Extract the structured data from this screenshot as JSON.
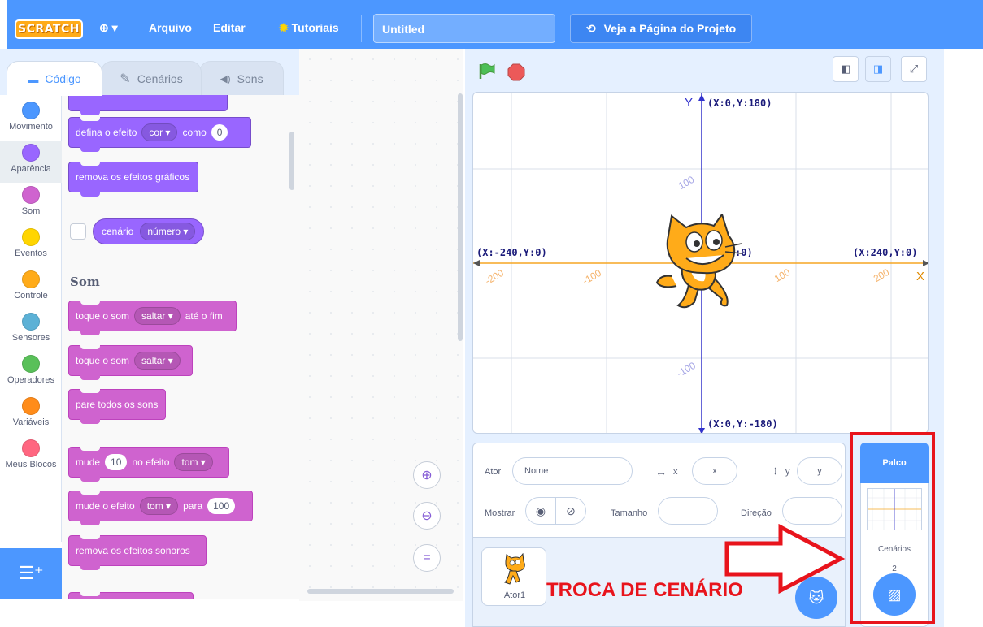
{
  "menubar": {
    "logo": "SCRATCH",
    "language_caret": "▾",
    "file": "Arquivo",
    "edit": "Editar",
    "tutorials": "Tutoriais",
    "project_title": "Untitled",
    "see_project_page": "Veja a Página do Projeto"
  },
  "tabs": [
    {
      "label": "Código"
    },
    {
      "label": "Cenários"
    },
    {
      "label": "Sons"
    }
  ],
  "categories": [
    {
      "label": "Movimento",
      "color": "#4c97ff"
    },
    {
      "label": "Aparência",
      "color": "#9966ff"
    },
    {
      "label": "Som",
      "color": "#cf63cf"
    },
    {
      "label": "Eventos",
      "color": "#ffd500"
    },
    {
      "label": "Controle",
      "color": "#ffab19"
    },
    {
      "label": "Sensores",
      "color": "#5cb1d6"
    },
    {
      "label": "Operadores",
      "color": "#59c059"
    },
    {
      "label": "Variáveis",
      "color": "#ff8c1a"
    },
    {
      "label": "Meus Blocos",
      "color": "#ff6680"
    }
  ],
  "blocks": {
    "set_effect": {
      "text": "defina o efeito",
      "dropdown": "cor ▾",
      "text2": "como",
      "value": "0"
    },
    "clear_effects": "remova os efeitos gráficos",
    "backdrop_reporter": {
      "text": "cenário",
      "dropdown": "número ▾"
    },
    "section_sound": "Som",
    "play_until_done": {
      "text": "toque o som",
      "dropdown": "saltar ▾",
      "text2": "até o fim"
    },
    "start_sound": {
      "text": "toque o som",
      "dropdown": "saltar ▾"
    },
    "stop_all": "pare todos os sons",
    "change_effect": {
      "text": "mude",
      "value": "10",
      "text2": "no efeito",
      "dropdown": "tom ▾"
    },
    "set_sound_effect": {
      "text": "mude o efeito",
      "dropdown": "tom ▾",
      "text2": "para",
      "value": "100"
    },
    "clear_sound_effects": "remova os efeitos sonoros"
  },
  "stage": {
    "y_axis_label": "Y",
    "x_axis_label": "X",
    "top": "(X:0,Y:180)",
    "bottom": "(X:0,Y:-180)",
    "left": "(X:-240,Y:0)",
    "right": "(X:240,Y:0)",
    "center_partial": ":0)",
    "tick_neg200": "-200",
    "tick_neg100": "-100",
    "tick_100x": "100",
    "tick_200x": "200",
    "tick_100y": "100",
    "tick_neg100y": "-100"
  },
  "sprite_info": {
    "sprite_label": "Ator",
    "name_placeholder": "Nome",
    "x_label": "x",
    "x_placeholder": "x",
    "y_label": "y",
    "y_placeholder": "y",
    "show_label": "Mostrar",
    "size_label": "Tamanho",
    "direction_label": "Direção"
  },
  "sprite_list": [
    {
      "name": "Ator1"
    }
  ],
  "stage_panel": {
    "title": "Palco",
    "backdrops_label": "Cenários",
    "backdrops_count": "2"
  },
  "annotation": {
    "caption": "TROCA DE CENÁRIO",
    "color": "#e8141c"
  }
}
